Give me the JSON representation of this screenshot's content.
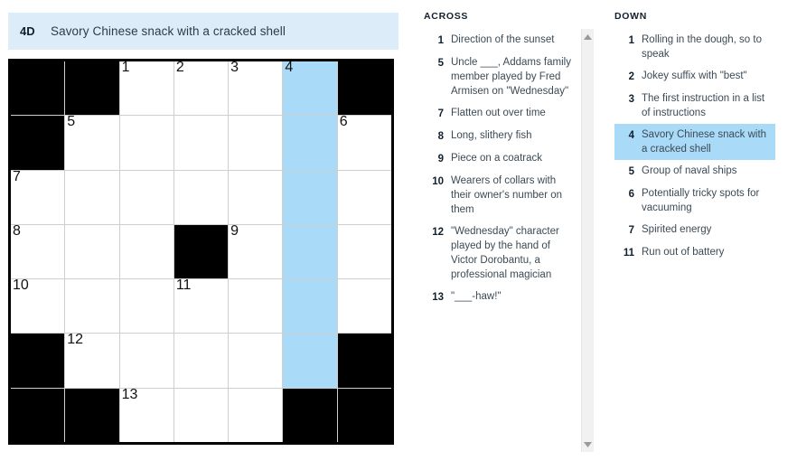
{
  "active_clue": {
    "label": "4D",
    "text": "Savory Chinese snack with a cracked shell"
  },
  "colors": {
    "cursor_cell": "#ffd60a",
    "highlight_cell": "#a9daf8",
    "banner_bg": "#dcedf9",
    "block": "#000000"
  },
  "grid": {
    "rows": 7,
    "cols": 7,
    "cells": [
      [
        {
          "type": "block"
        },
        {
          "type": "block"
        },
        {
          "type": "open",
          "number": "1"
        },
        {
          "type": "open",
          "number": "2"
        },
        {
          "type": "open",
          "number": "3"
        },
        {
          "type": "cursor",
          "number": "4"
        },
        {
          "type": "block"
        }
      ],
      [
        {
          "type": "block"
        },
        {
          "type": "open",
          "number": "5"
        },
        {
          "type": "open",
          "number": ""
        },
        {
          "type": "open",
          "number": ""
        },
        {
          "type": "open",
          "number": ""
        },
        {
          "type": "highlight",
          "number": ""
        },
        {
          "type": "open",
          "number": "6"
        }
      ],
      [
        {
          "type": "open",
          "number": "7"
        },
        {
          "type": "open",
          "number": ""
        },
        {
          "type": "open",
          "number": ""
        },
        {
          "type": "open",
          "number": ""
        },
        {
          "type": "open",
          "number": ""
        },
        {
          "type": "highlight",
          "number": ""
        },
        {
          "type": "open",
          "number": ""
        }
      ],
      [
        {
          "type": "open",
          "number": "8"
        },
        {
          "type": "open",
          "number": ""
        },
        {
          "type": "open",
          "number": ""
        },
        {
          "type": "block"
        },
        {
          "type": "open",
          "number": "9"
        },
        {
          "type": "highlight",
          "number": ""
        },
        {
          "type": "open",
          "number": ""
        }
      ],
      [
        {
          "type": "open",
          "number": "10"
        },
        {
          "type": "open",
          "number": ""
        },
        {
          "type": "open",
          "number": ""
        },
        {
          "type": "open",
          "number": "11"
        },
        {
          "type": "open",
          "number": ""
        },
        {
          "type": "highlight",
          "number": ""
        },
        {
          "type": "open",
          "number": ""
        }
      ],
      [
        {
          "type": "block"
        },
        {
          "type": "open",
          "number": "12"
        },
        {
          "type": "open",
          "number": ""
        },
        {
          "type": "open",
          "number": ""
        },
        {
          "type": "open",
          "number": ""
        },
        {
          "type": "highlight",
          "number": ""
        },
        {
          "type": "block"
        }
      ],
      [
        {
          "type": "block"
        },
        {
          "type": "block"
        },
        {
          "type": "open",
          "number": "13"
        },
        {
          "type": "open",
          "number": ""
        },
        {
          "type": "open",
          "number": ""
        },
        {
          "type": "block"
        },
        {
          "type": "block"
        }
      ]
    ]
  },
  "across": {
    "heading": "ACROSS",
    "clues": [
      {
        "number": "1",
        "text": "Direction of the sunset",
        "selected": false,
        "marker": true
      },
      {
        "number": "5",
        "text": "Uncle ___, Addams family member played by Fred Armisen on \"Wednesday\"",
        "selected": false,
        "marker": false
      },
      {
        "number": "7",
        "text": "Flatten out over time",
        "selected": false,
        "marker": false
      },
      {
        "number": "8",
        "text": "Long, slithery fish",
        "selected": false,
        "marker": false
      },
      {
        "number": "9",
        "text": "Piece on a coatrack",
        "selected": false,
        "marker": false
      },
      {
        "number": "10",
        "text": "Wearers of collars with their owner's number on them",
        "selected": false,
        "marker": false
      },
      {
        "number": "12",
        "text": "\"Wednesday\" character played by the hand of Victor Dorobantu, a professional magician",
        "selected": false,
        "marker": false
      },
      {
        "number": "13",
        "text": "\"___-haw!\"",
        "selected": false,
        "marker": false
      }
    ]
  },
  "down": {
    "heading": "DOWN",
    "clues": [
      {
        "number": "1",
        "text": "Rolling in the dough, so to speak",
        "selected": false,
        "marker": false
      },
      {
        "number": "2",
        "text": "Jokey suffix with \"best\"",
        "selected": false,
        "marker": false
      },
      {
        "number": "3",
        "text": "The first instruction in a list of instructions",
        "selected": false,
        "marker": false
      },
      {
        "number": "4",
        "text": "Savory Chinese snack with a cracked shell",
        "selected": true,
        "marker": false
      },
      {
        "number": "5",
        "text": "Group of naval ships",
        "selected": false,
        "marker": false
      },
      {
        "number": "6",
        "text": "Potentially tricky spots for vacuuming",
        "selected": false,
        "marker": false
      },
      {
        "number": "7",
        "text": "Spirited energy",
        "selected": false,
        "marker": false
      },
      {
        "number": "11",
        "text": "Run out of battery",
        "selected": false,
        "marker": false
      }
    ]
  },
  "scrollbars": {
    "across": {
      "up_icon": "scroll-up-arrow",
      "down_icon": "scroll-down-arrow"
    },
    "down": {
      "up_icon": "scroll-up-arrow",
      "down_icon": "scroll-down-arrow"
    }
  }
}
